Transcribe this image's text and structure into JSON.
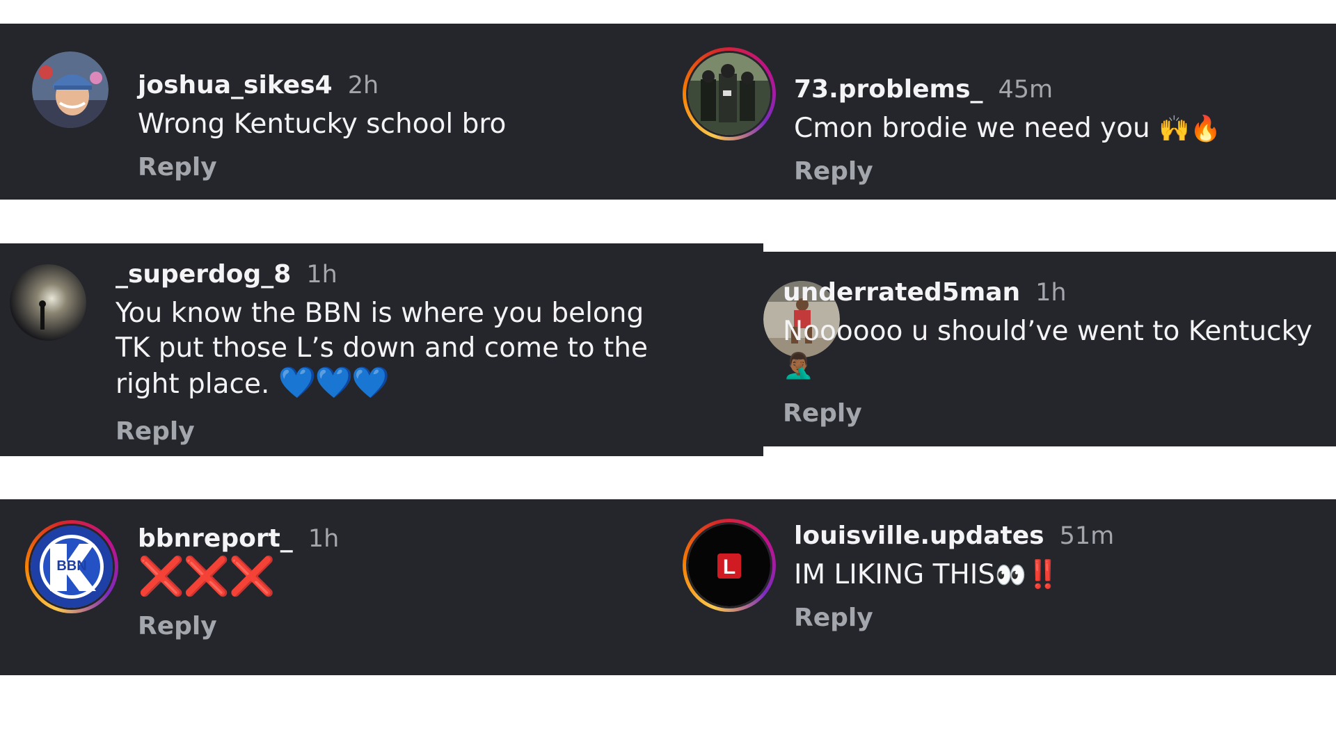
{
  "comments": [
    {
      "username": "joshua_sikes4",
      "time": "2h",
      "text": "Wrong Kentucky school bro",
      "reply": "Reply"
    },
    {
      "username": "73.problems_",
      "time": "45m",
      "text": "Cmon brodie we need you",
      "emoji": "🙌🔥",
      "reply": "Reply"
    },
    {
      "username": "_superdog_8",
      "time": "1h",
      "text_lines": [
        "You know the BBN is where you belong",
        "TK put those L’s down and come to the",
        "right place."
      ],
      "hearts": "💙💙💙",
      "reply": "Reply"
    },
    {
      "username": "underrated5man",
      "time": "1h",
      "text": "Noooooo u should’ve went to Kentucky",
      "emoji": "🤦🏾‍♂️",
      "reply": "Reply"
    },
    {
      "username": "bbnreport_",
      "time": "1h",
      "xmarks": "❌❌❌",
      "reply": "Reply"
    },
    {
      "username": "louisville.updates",
      "time": "51m",
      "text": "IM LIKING THIS",
      "emoji": "👀",
      "bang": "‼️",
      "reply": "Reply"
    }
  ],
  "colors": {
    "panel": "#25262b",
    "username": "#f4f4f6",
    "muted": "#a4a6ad",
    "heart": "#22a5ee",
    "red": "#e0242c"
  },
  "avatars": {
    "bbnreport_": {
      "logo_text": "BBN"
    },
    "louisville.updates": {
      "logo_text": "L"
    }
  }
}
